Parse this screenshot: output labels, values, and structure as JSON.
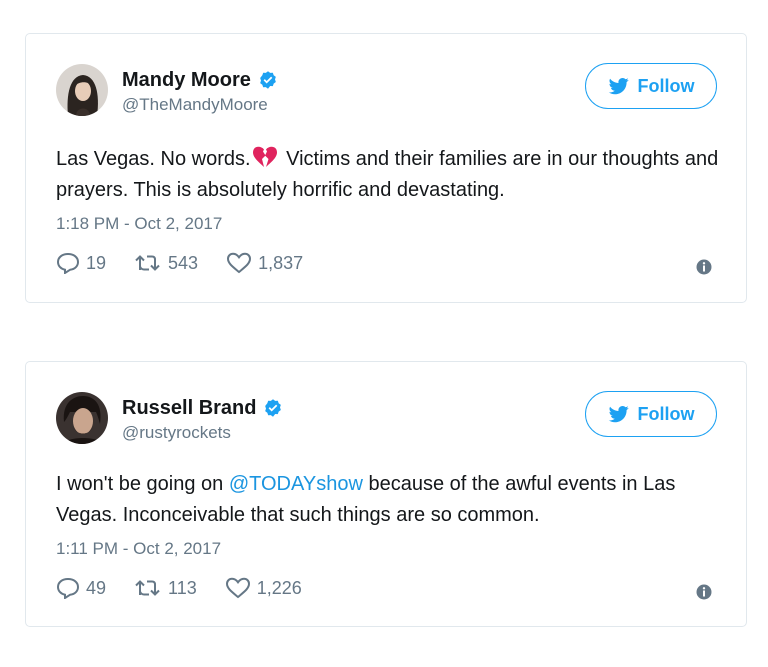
{
  "colors": {
    "accent": "#1da1f2",
    "mention": "#1b95e0",
    "secondary_text": "#657786",
    "border": "#e1e8ed",
    "broken_heart": "#e0245e"
  },
  "tweets": [
    {
      "author_name": "Mandy Moore",
      "handle": "@TheMandyMoore",
      "verified": true,
      "follow_label": "Follow",
      "text_part1": "Las Vegas. No words.",
      "emoji": "broken-heart",
      "text_part2": " Victims and their families are in our thoughts and prayers. This is absolutely horrific and devastating.",
      "timestamp": "1:18 PM - Oct 2, 2017",
      "replies": "19",
      "retweets": "543",
      "likes": "1,837",
      "icons": [
        "reply-icon",
        "retweet-icon",
        "like-icon",
        "info-icon"
      ]
    },
    {
      "author_name": "Russell Brand",
      "handle": "@rustyrockets",
      "verified": true,
      "follow_label": "Follow",
      "text_part1": "I won't be going on ",
      "mention": "@TODAYshow",
      "text_part2": " because of the awful events in Las Vegas. Inconceivable that such things are so common.",
      "timestamp": "1:11 PM - Oct 2, 2017",
      "replies": "49",
      "retweets": "113",
      "likes": "1,226",
      "icons": [
        "reply-icon",
        "retweet-icon",
        "like-icon",
        "info-icon"
      ]
    }
  ]
}
